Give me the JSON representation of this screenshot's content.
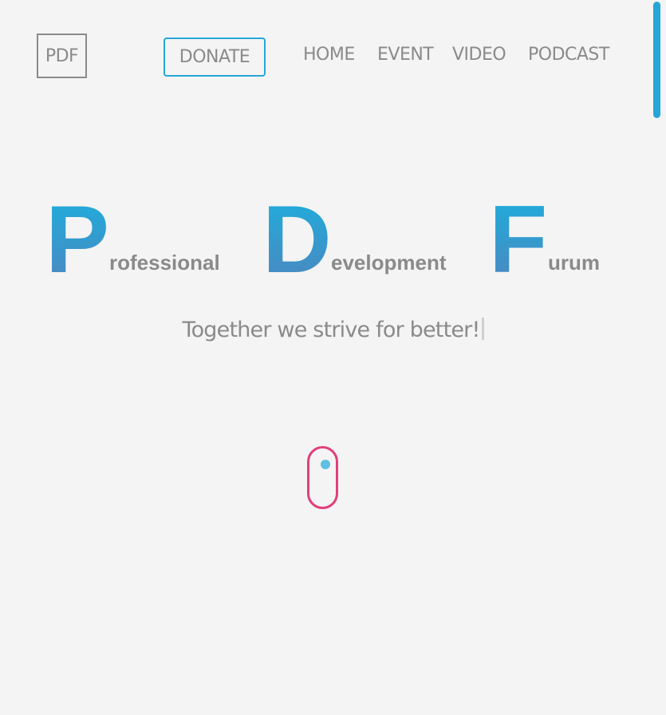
{
  "header": {
    "logo_text": "PDF",
    "donate_label": "DONATE",
    "nav": [
      {
        "label": "HOME"
      },
      {
        "label": "EVENT"
      },
      {
        "label": "VIDEO"
      },
      {
        "label": "PODCAST"
      }
    ]
  },
  "hero": {
    "words": [
      {
        "initial": "P",
        "rest": "rofessional"
      },
      {
        "initial": "D",
        "rest": "evelopment"
      },
      {
        "initial": "F",
        "rest": "urum"
      }
    ],
    "tagline": "Together we strive for better!"
  },
  "colors": {
    "accent_blue": "#26a6d6",
    "text_gray": "#8a8a8a",
    "mouse_pink": "#e0407c",
    "background": "#f4f4f4"
  },
  "icons": {
    "scroll_indicator": "mouse-scroll-icon"
  }
}
